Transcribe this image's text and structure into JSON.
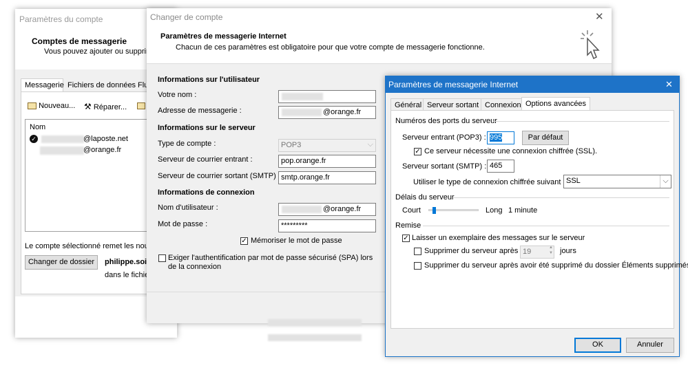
{
  "back_window": {
    "title": "Paramètres du compte",
    "heading": "Comptes de messagerie",
    "subheading": "Vous pouvez ajouter ou supprimer",
    "tabs": [
      "Messagerie",
      "Fichiers de données",
      "Flu"
    ],
    "toolbar": {
      "new_label": "Nouveau...",
      "repair_label": "Réparer..."
    },
    "list_header": "Nom",
    "accounts": [
      "@laposte.net",
      "@orange.fr"
    ],
    "selected_note": "Le compte sélectionné remet les nouve",
    "change_folder_label": "Changer de dossier",
    "user_name": "philippe.soi",
    "folder_note": "dans le fichier"
  },
  "mid_window": {
    "title": "Changer de compte",
    "heading": "Paramètres de messagerie Internet",
    "subheading": "Chacun de ces paramètres est obligatoire pour que votre compte de messagerie fonctionne.",
    "user_section": "Informations sur l'utilisateur",
    "name_label": "Votre nom :",
    "email_label": "Adresse de messagerie :",
    "email_value": "@orange.fr",
    "server_section": "Informations sur le serveur",
    "account_type_label": "Type de compte :",
    "account_type_value": "POP3",
    "incoming_label": "Serveur de courrier entrant :",
    "incoming_value": "pop.orange.fr",
    "outgoing_label": "Serveur de courrier sortant (SMTP) :",
    "outgoing_value": "smtp.orange.fr",
    "login_section": "Informations de connexion",
    "username_label": "Nom d'utilisateur :",
    "username_value": "@orange.fr",
    "password_label": "Mot de passe :",
    "password_value": "*********",
    "remember_label": "Mémoriser le mot de passe",
    "spa_label_1": "Exiger l'authentification par mot de passe sécurisé (SPA) lors",
    "spa_label_2": "de la connexion"
  },
  "front_window": {
    "title": "Paramètres de messagerie Internet",
    "close_glyph": "✕",
    "tabs": [
      "Général",
      "Serveur sortant",
      "Connexion",
      "Options avancées"
    ],
    "ports_section": "Numéros des ports du serveur",
    "incoming_port_label": "Serveur entrant (POP3) :",
    "incoming_port_value": "995",
    "default_button": "Par défaut",
    "ssl_required_label": "Ce serveur nécessite une connexion chiffrée (SSL).",
    "outgoing_port_label": "Serveur sortant (SMTP) :",
    "outgoing_port_value": "465",
    "encryption_label": "Utiliser le type de connexion chiffrée suivant :",
    "encryption_value": "SSL",
    "timeout_section": "Délais du serveur",
    "timeout_short": "Court",
    "timeout_long": "Long",
    "timeout_value": "1 minute",
    "delivery_section": "Remise",
    "leave_copy_label": "Laisser un exemplaire des messages sur le serveur",
    "delete_after_label": "Supprimer du serveur après",
    "delete_days_value": "19",
    "days_label": "jours",
    "delete_when_removed_label": "Supprimer du serveur après avoir été supprimé du dossier Éléments supprimés",
    "ok_label": "OK",
    "cancel_label": "Annuler",
    "checks": {
      "ssl_required": true,
      "leave_copy": true,
      "delete_after": false,
      "delete_when_removed": false
    }
  }
}
